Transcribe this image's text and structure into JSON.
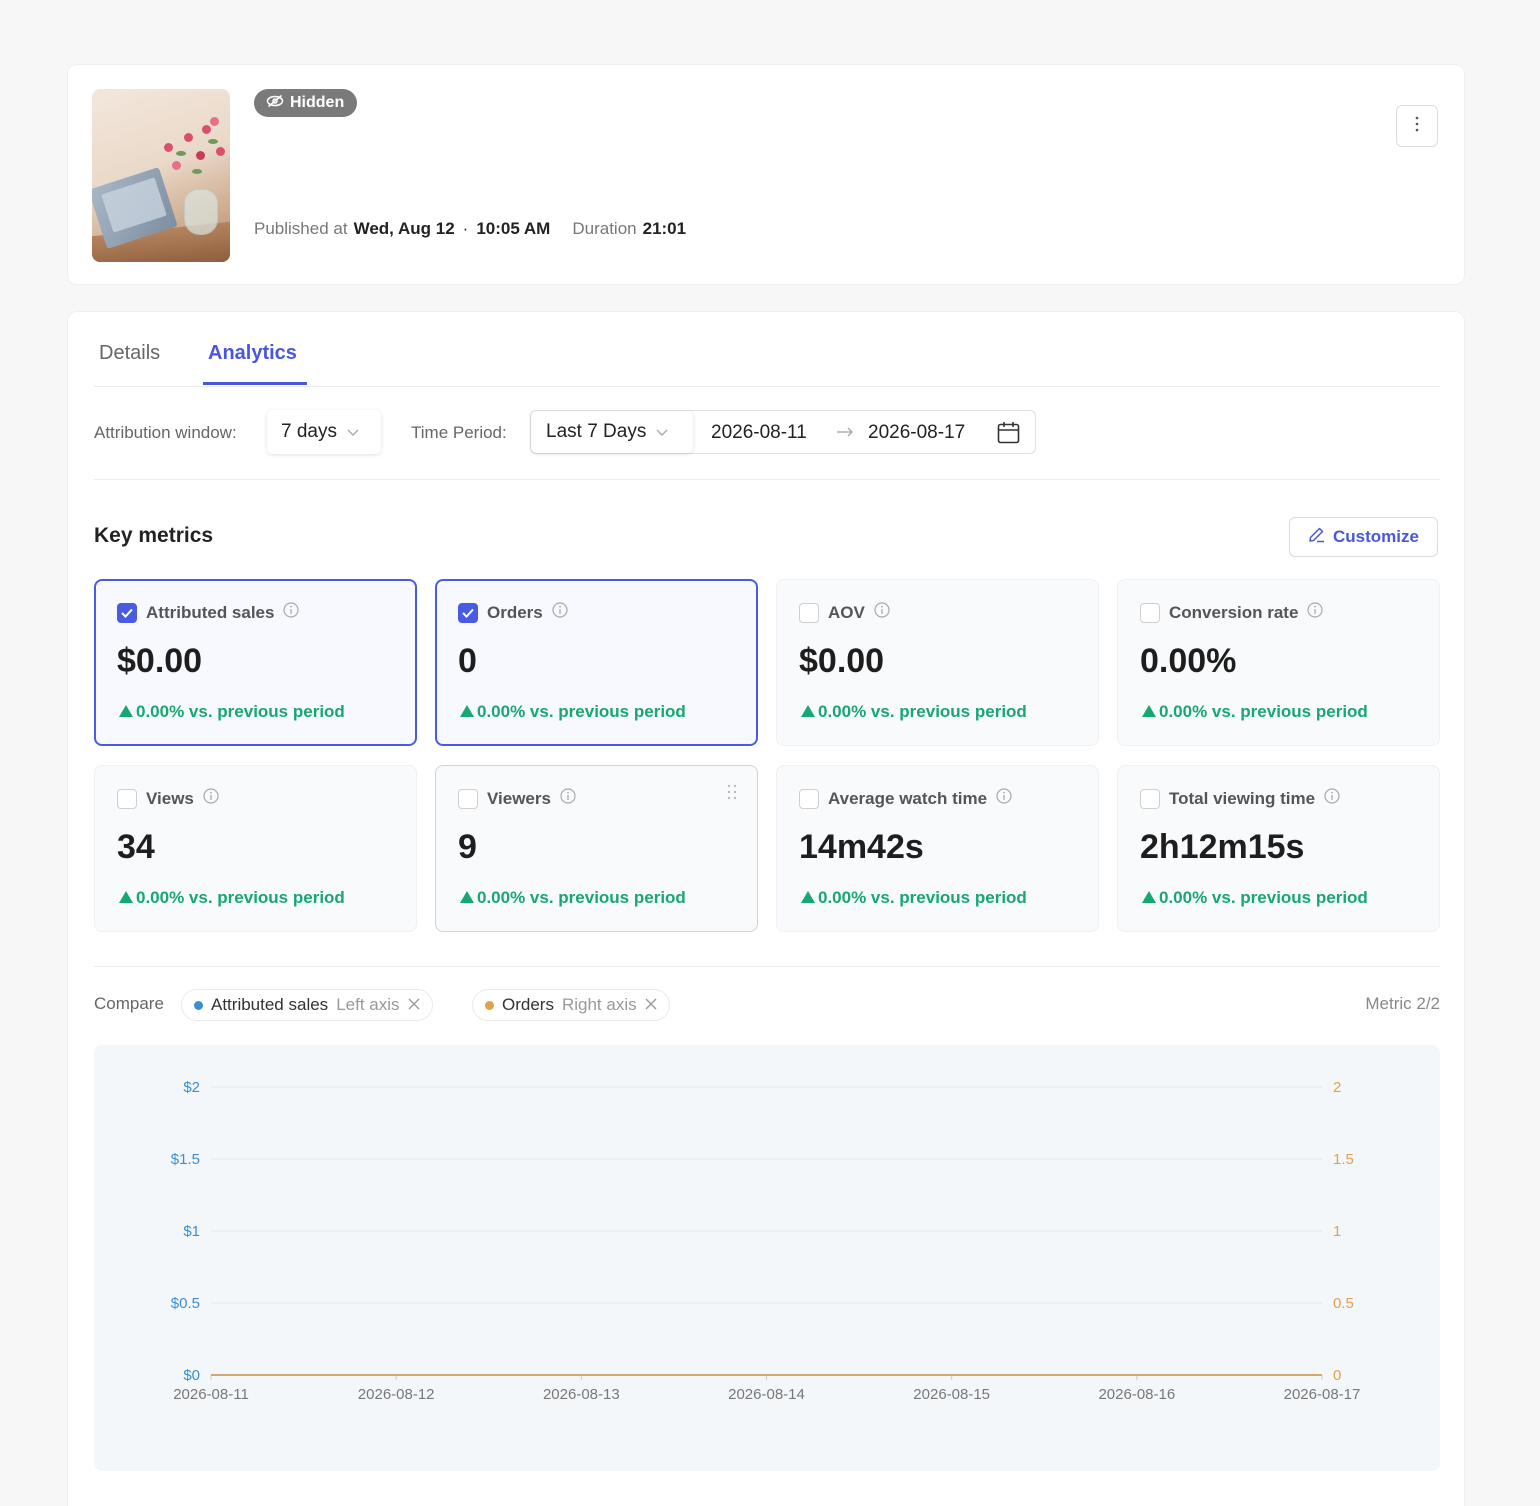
{
  "header": {
    "status_badge": "Hidden",
    "published_label": "Published at",
    "published_date": "Wed, Aug 12",
    "published_sep": "·",
    "published_time": "10:05 AM",
    "duration_label": "Duration",
    "duration_value": "21:01"
  },
  "tabs": [
    {
      "label": "Details",
      "active": false
    },
    {
      "label": "Analytics",
      "active": true
    }
  ],
  "filters": {
    "attribution_label": "Attribution window:",
    "attribution_value": "7 days",
    "period_label": "Time Period:",
    "period_preset": "Last 7 Days",
    "start_date": "2026-08-11",
    "end_date": "2026-08-17"
  },
  "key_metrics": {
    "title": "Key metrics",
    "customize_label": "Customize",
    "items": [
      {
        "label": "Attributed sales",
        "value": "$0.00",
        "change": "0.00% vs. previous period",
        "checked": true
      },
      {
        "label": "Orders",
        "value": "0",
        "change": "0.00% vs. previous period",
        "checked": true
      },
      {
        "label": "AOV",
        "value": "$0.00",
        "change": "0.00% vs. previous period",
        "checked": false
      },
      {
        "label": "Conversion rate",
        "value": "0.00%",
        "change": "0.00% vs. previous period",
        "checked": false
      },
      {
        "label": "Views",
        "value": "34",
        "change": "0.00% vs. previous period",
        "checked": false
      },
      {
        "label": "Viewers",
        "value": "9",
        "change": "0.00% vs. previous period",
        "checked": false
      },
      {
        "label": "Average watch time",
        "value": "14m42s",
        "change": "0.00% vs. previous period",
        "checked": false
      },
      {
        "label": "Total viewing time",
        "value": "2h12m15s",
        "change": "0.00% vs. previous period",
        "checked": false
      }
    ]
  },
  "compare": {
    "label": "Compare",
    "chips": [
      {
        "name": "Attributed sales",
        "axis": "Left axis",
        "color": "#3a8fd0"
      },
      {
        "name": "Orders",
        "axis": "Right axis",
        "color": "#e3a04a"
      }
    ],
    "metric_count": "Metric 2/2"
  },
  "colors": {
    "accent": "#4856e0",
    "positive": "#17a773",
    "left_series": "#3a8fd0",
    "right_series": "#e3a04a"
  },
  "chart_data": {
    "type": "line",
    "x": [
      "2026-08-11",
      "2026-08-12",
      "2026-08-13",
      "2026-08-14",
      "2026-08-15",
      "2026-08-16",
      "2026-08-17"
    ],
    "series": [
      {
        "name": "Attributed sales",
        "axis": "left",
        "values": [
          0,
          0,
          0,
          0,
          0,
          0,
          0
        ]
      },
      {
        "name": "Orders",
        "axis": "right",
        "values": [
          0,
          0,
          0,
          0,
          0,
          0,
          0
        ]
      }
    ],
    "y_left": {
      "ticks": [
        "$0",
        "$0.5",
        "$1",
        "$1.5",
        "$2"
      ],
      "ylim": [
        0,
        2
      ]
    },
    "y_right": {
      "ticks": [
        "0",
        "0.5",
        "1",
        "1.5",
        "2"
      ],
      "ylim": [
        0,
        2
      ]
    },
    "grid": true,
    "legend": "top-left"
  }
}
